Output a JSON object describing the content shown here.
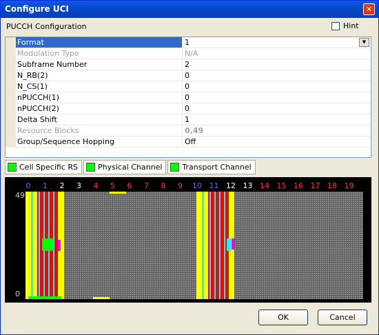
{
  "window": {
    "title": "Configure UCI",
    "close_glyph": "✕"
  },
  "header": {
    "label": "PUCCH Configuration",
    "hint_label": "Hint"
  },
  "properties": [
    {
      "name": "Format",
      "value": "1"
    },
    {
      "name": "Modulation Type",
      "value": "N/A"
    },
    {
      "name": "Subframe Number",
      "value": "2"
    },
    {
      "name": "N_RB(2)",
      "value": "0"
    },
    {
      "name": "N_CS(1)",
      "value": "0"
    },
    {
      "name": "nPUCCH(1)",
      "value": "0"
    },
    {
      "name": "nPUCCH(2)",
      "value": "0"
    },
    {
      "name": "Delta Shift",
      "value": "1"
    },
    {
      "name": "Resource Blocks",
      "value": "0,49"
    },
    {
      "name": "Group/Sequence Hopping",
      "value": "Off"
    }
  ],
  "legend": [
    {
      "label": "Cell Specific RS",
      "color": "#00ff00"
    },
    {
      "label": "Physical Channel",
      "color": "#00ff00"
    },
    {
      "label": "Transport Channel",
      "color": "#00ff00"
    }
  ],
  "plot": {
    "slots": [
      "0",
      "1",
      "2",
      "3",
      "4",
      "5",
      "6",
      "7",
      "8",
      "9",
      "10",
      "11",
      "12",
      "13",
      "14",
      "15",
      "16",
      "17",
      "18",
      "19"
    ],
    "slot_colors": [
      "#4a6cff",
      "#4a6cff",
      "#ffffff",
      "#ffffff",
      "#ff3030",
      "#ff3030",
      "#ff3030",
      "#ff3030",
      "#ff3030",
      "#ff3030",
      "#4a6cff",
      "#4a6cff",
      "#ffffff",
      "#ffffff",
      "#ff3030",
      "#ff3030",
      "#ff3030",
      "#ff3030",
      "#ff3030",
      "#ff3030"
    ],
    "y_top": "49",
    "y_bottom": "0",
    "colors": {
      "rs": "#ffff00",
      "pucch": "#ff0000",
      "cyan": "#00ffff",
      "green": "#00ff00",
      "magenta": "#ff00ff"
    }
  },
  "buttons": {
    "ok": "OK",
    "cancel": "Cancel"
  }
}
